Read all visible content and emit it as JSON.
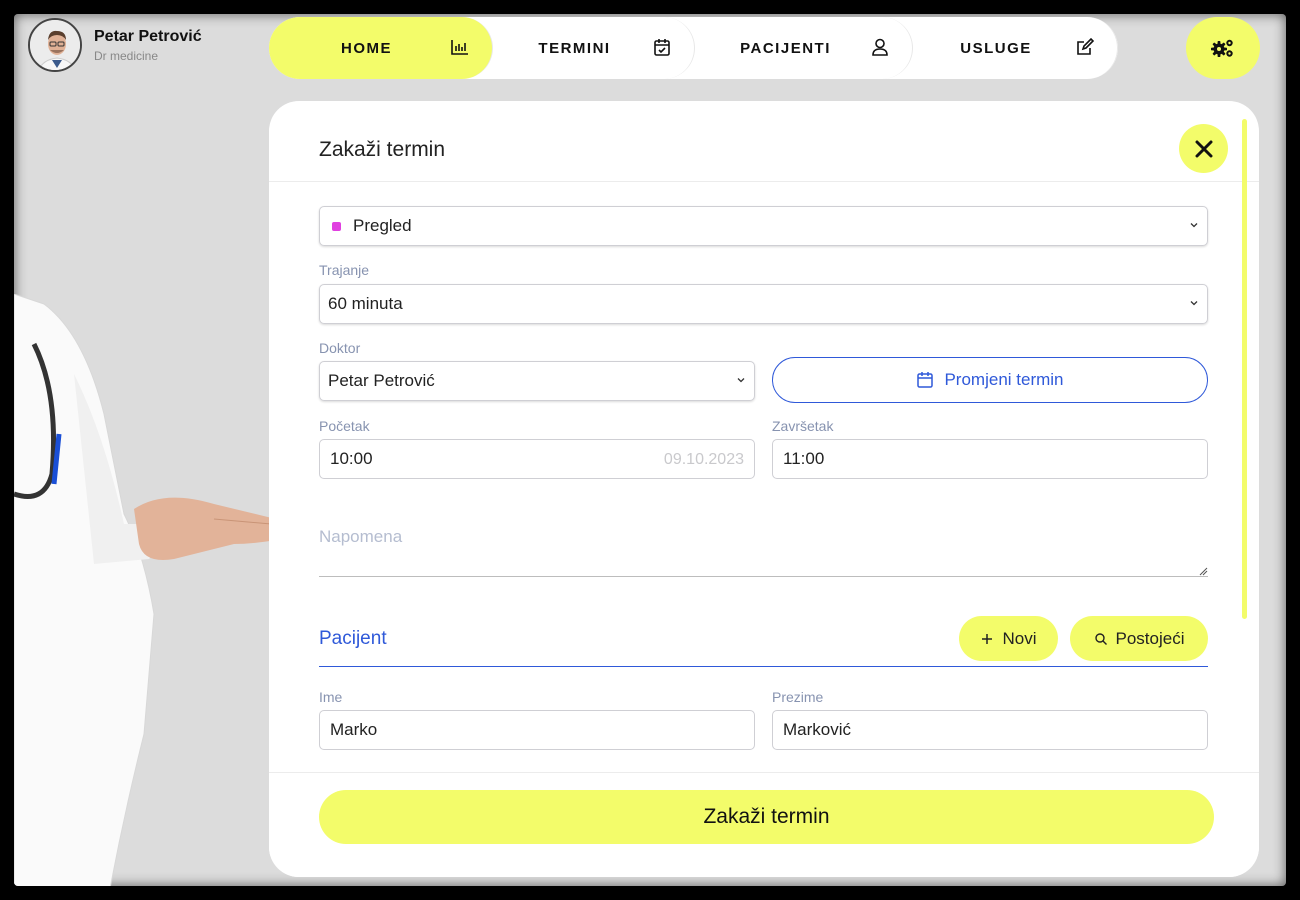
{
  "profile": {
    "name": "Petar Petrović",
    "role": "Dr medicine"
  },
  "nav": {
    "items": [
      {
        "label": "HOME",
        "icon": "bar-chart-icon"
      },
      {
        "label": "TERMINI",
        "icon": "calendar-check-icon"
      },
      {
        "label": "PACIJENTI",
        "icon": "user-icon"
      },
      {
        "label": "USLUGE",
        "icon": "edit-icon"
      }
    ],
    "settings_icon": "gears-icon",
    "active_color": "#f3fc6a"
  },
  "modal": {
    "title": "Zakaži termin",
    "type": {
      "value": "Pregled",
      "color": "#e040e0"
    },
    "duration": {
      "label": "Trajanje",
      "value": "60 minuta"
    },
    "doctor": {
      "label": "Doktor",
      "value": "Petar Petrović"
    },
    "change_button": "Promjeni termin",
    "start": {
      "label": "Početak",
      "value": "10:00",
      "date": "09.10.2023"
    },
    "end": {
      "label": "Završetak",
      "value": "11:00"
    },
    "note": {
      "placeholder": "Napomena"
    },
    "patient": {
      "title": "Pacijent",
      "new_button": "Novi",
      "existing_button": "Postojeći",
      "first_name": {
        "label": "Ime",
        "value": "Marko"
      },
      "last_name": {
        "label": "Prezime",
        "value": "Marković"
      }
    },
    "submit": "Zakaži termin"
  },
  "colors": {
    "accent": "#f3fc6a",
    "link": "#2f59d9"
  }
}
